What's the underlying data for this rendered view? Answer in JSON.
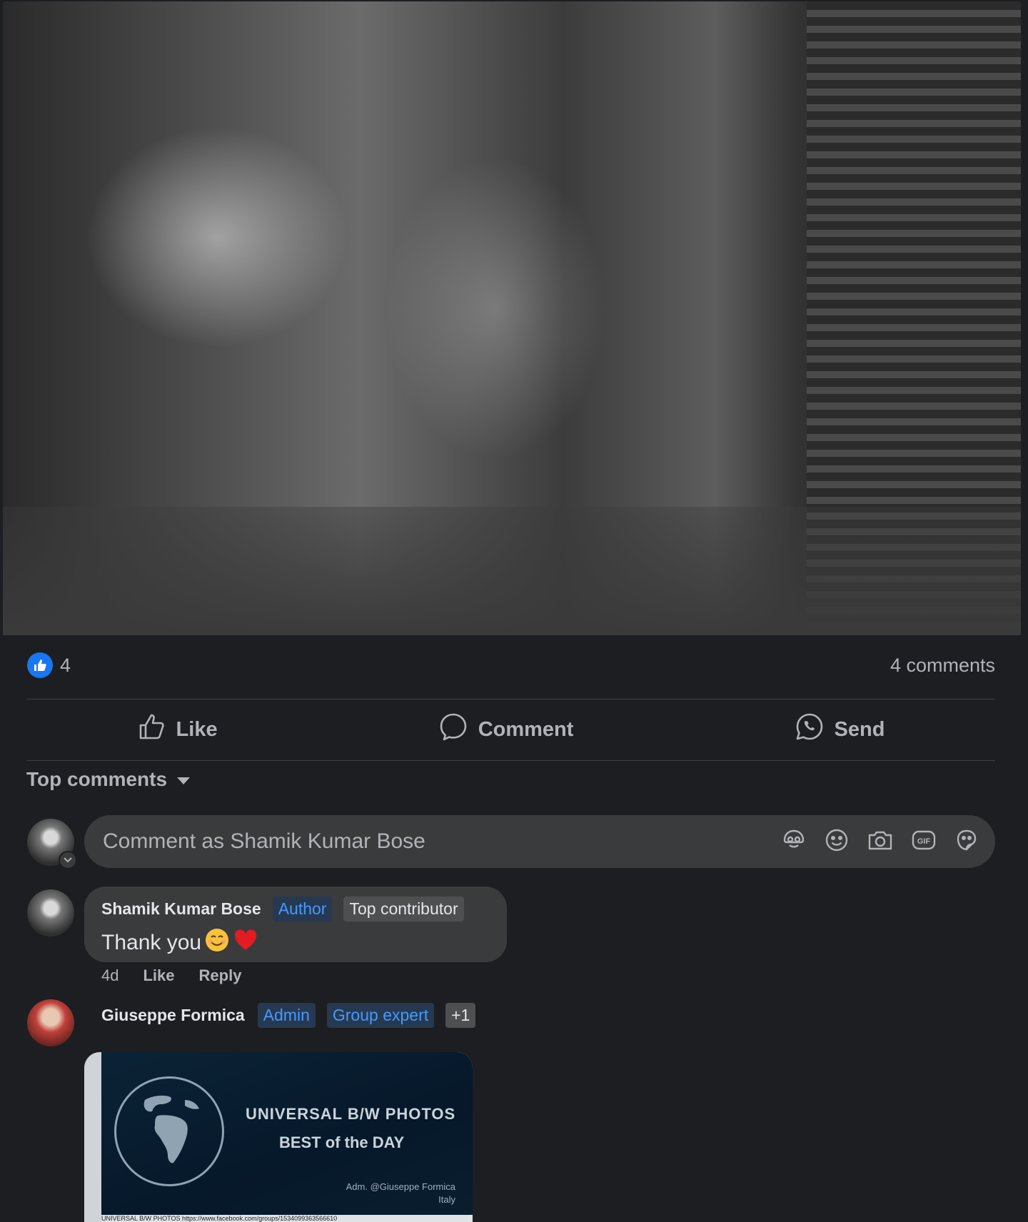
{
  "post": {
    "reactions": {
      "icon": "like-icon",
      "count": "4"
    },
    "comment_count": "4 comments"
  },
  "actions": {
    "like": "Like",
    "comment": "Comment",
    "send": "Send"
  },
  "comments_section": {
    "sort_label": "Top comments"
  },
  "composer": {
    "placeholder": "Comment as Shamik Kumar Bose",
    "icons": [
      "avatar-sticker-icon",
      "emoji-icon",
      "camera-icon",
      "gif-icon",
      "sticker-icon"
    ]
  },
  "comments": [
    {
      "author": "Shamik Kumar Bose",
      "badges": [
        "Author",
        "Top contributor"
      ],
      "text": "Thank you",
      "time": "4d",
      "like": "Like",
      "reply": "Reply"
    },
    {
      "author": "Giuseppe Formica",
      "badges": [
        "Admin",
        "Group expert",
        "+1"
      ],
      "attachment": {
        "title_line1": "UNIVERSAL B/W PHOTOS",
        "title_line2": "BEST of the DAY",
        "credit_line1": "Adm. @Giuseppe Formica",
        "credit_line2": "Italy",
        "footer": "UNIVERSAL B/W PHOTOS https://www.facebook.com/groups/1534099363566610"
      }
    }
  ],
  "colors": {
    "background": "#1c1e21",
    "accent": "#1877f2",
    "badge_blue_text": "#4599ff",
    "surface": "#3a3b3c"
  }
}
